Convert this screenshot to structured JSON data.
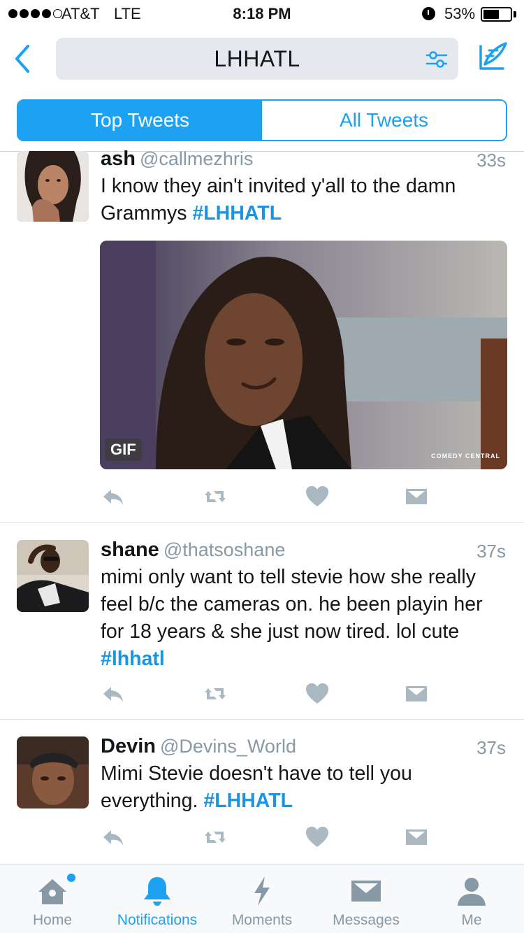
{
  "status_bar": {
    "carrier": "AT&T",
    "network": "LTE",
    "time": "8:18 PM",
    "battery": "53%",
    "battery_level": 0.53
  },
  "nav": {
    "back_icon": "chevron-left-icon",
    "search_query": "LHHATL",
    "filter_icon": "sliders-icon",
    "compose_icon": "compose-feather-icon"
  },
  "segments": {
    "top": "Top Tweets",
    "all": "All Tweets",
    "selected": "Top Tweets"
  },
  "tweets": [
    {
      "name": "ash",
      "handle": "@callmezhris",
      "time": "33s",
      "text": "I know they ain't invited y'all to the damn Grammys ",
      "hashtag": "#LHHATL",
      "media": {
        "badge": "GIF",
        "watermark": "COMEDY CENTRAL"
      }
    },
    {
      "name": "shane",
      "handle": "@thatsoshane",
      "time": "37s",
      "text": "mimi only want to tell stevie how she really feel b/c the cameras on. he been playin her for 18 years & she just now tired. lol cute ",
      "hashtag": "#lhhatl"
    },
    {
      "name": "Devin",
      "handle": "@Devins_World",
      "time": "37s",
      "text": "Mimi Stevie doesn't have to tell you everything. ",
      "hashtag": "#LHHATL"
    }
  ],
  "tab_bar": {
    "home": "Home",
    "notifications": "Notifications",
    "moments": "Moments",
    "messages": "Messages",
    "me": "Me",
    "active": "Notifications"
  },
  "colors": {
    "accent": "#1da1f2",
    "hashtag": "#1b95e0",
    "muted": "#8899a6",
    "action_icon": "#aab8c2"
  }
}
